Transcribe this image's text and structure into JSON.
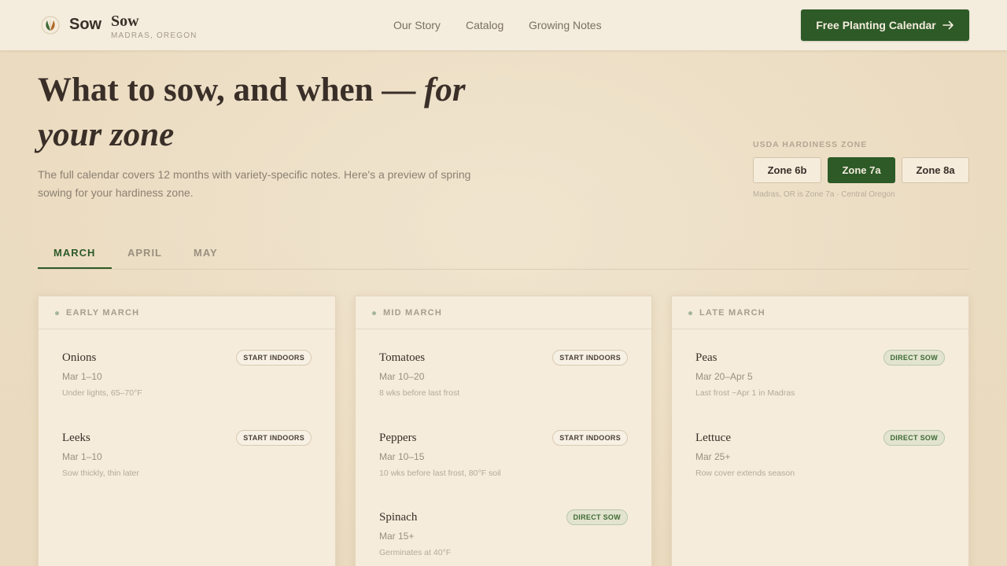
{
  "header": {
    "brand_main": "Sow",
    "brand_name": "Sow",
    "brand_location": "MADRAS, OREGON",
    "nav": [
      "Our Story",
      "Catalog",
      "Growing Notes"
    ],
    "cta_label": "Free Planting Calendar",
    "cta_icon": "arrow-right-icon"
  },
  "hero": {
    "title_plain": "What to sow, and when —",
    "title_italic_1": "for",
    "title_italic_2": "your zone",
    "subtitle": "The full calendar covers 12 months with variety-specific notes. Here's a preview of spring sowing for your hardiness zone."
  },
  "zones": {
    "label": "USDA HARDINESS ZONE",
    "options": [
      "Zone 6b",
      "Zone 7a",
      "Zone 8a"
    ],
    "selected": "Zone 7a",
    "note": "Madras, OR is Zone 7a · Central Oregon"
  },
  "tabs": {
    "items": [
      "MARCH",
      "APRIL",
      "MAY"
    ],
    "active": "MARCH"
  },
  "cards": [
    {
      "title": "EARLY MARCH",
      "crops": [
        {
          "name": "Onions",
          "badge": "START INDOORS",
          "date": "Mar 1–10",
          "note": "Under lights, 65–70°F"
        },
        {
          "name": "Leeks",
          "badge": "START INDOORS",
          "date": "Mar 1–10",
          "note": "Sow thickly, thin later"
        }
      ]
    },
    {
      "title": "MID MARCH",
      "crops": [
        {
          "name": "Tomatoes",
          "badge": "START INDOORS",
          "date": "Mar 10–20",
          "note": "8 wks before last frost"
        },
        {
          "name": "Peppers",
          "badge": "START INDOORS",
          "date": "Mar 10–15",
          "note": "10 wks before last frost, 80°F soil"
        },
        {
          "name": "Spinach",
          "badge": "DIRECT SOW",
          "date": "Mar 15+",
          "note": "Germinates at 40°F"
        }
      ]
    },
    {
      "title": "LATE MARCH",
      "crops": [
        {
          "name": "Peas",
          "badge": "DIRECT SOW",
          "date": "Mar 20–Apr 5",
          "note": "Last frost ~Apr 1 in Madras"
        },
        {
          "name": "Lettuce",
          "badge": "DIRECT SOW",
          "date": "Mar 25+",
          "note": "Row cover extends season"
        }
      ]
    }
  ],
  "colors": {
    "accent_green": "#2d5a27",
    "background": "#ecdfc6",
    "text_dark": "#3a2f28"
  }
}
